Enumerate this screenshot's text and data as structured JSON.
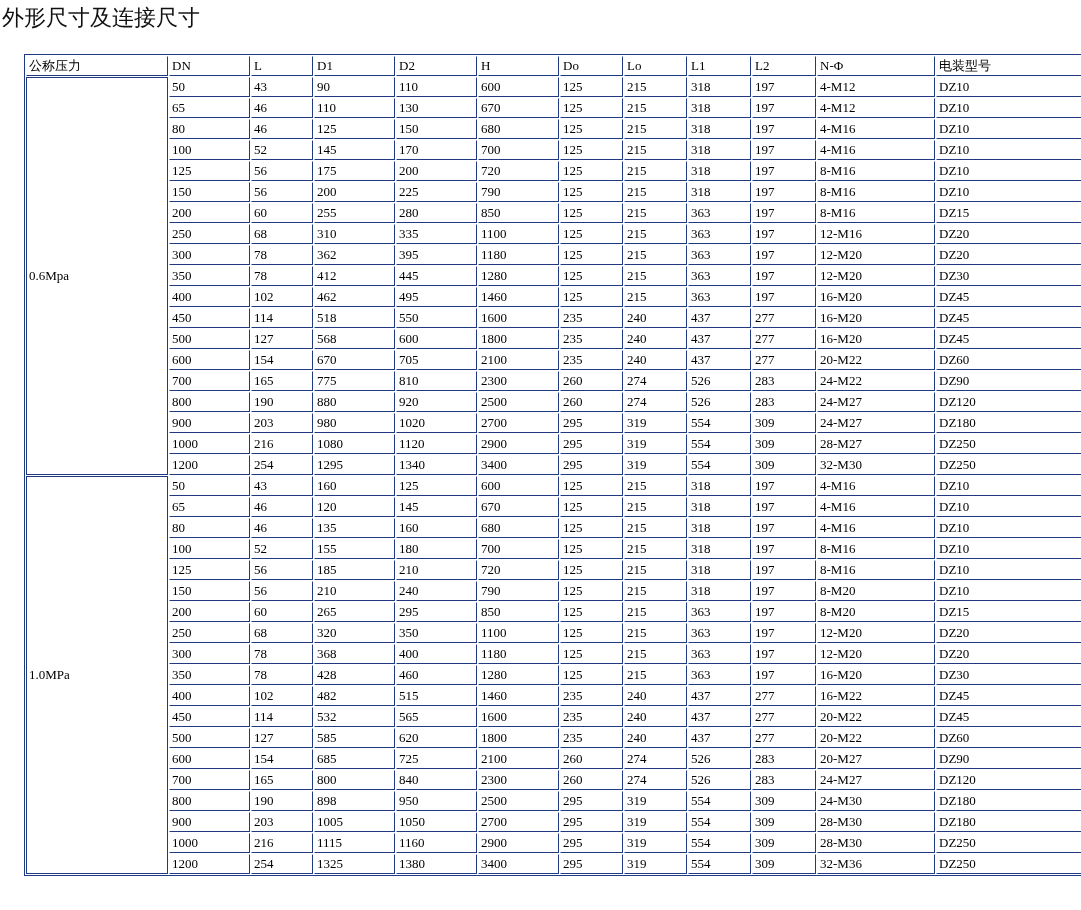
{
  "title": "外形尺寸及连接尺寸",
  "table": {
    "columns": [
      "公称压力",
      "DN",
      "L",
      "D1",
      "D2",
      "H",
      "Do",
      "Lo",
      "L1",
      "L2",
      "N-Φ",
      "电装型号"
    ],
    "groups": [
      {
        "pressure": "0.6Mpa",
        "rows": [
          [
            "50",
            "43",
            "90",
            "110",
            "600",
            "125",
            "215",
            "318",
            "197",
            "4-M12",
            "DZ10"
          ],
          [
            "65",
            "46",
            "110",
            "130",
            "670",
            "125",
            "215",
            "318",
            "197",
            "4-M12",
            "DZ10"
          ],
          [
            "80",
            "46",
            "125",
            "150",
            "680",
            "125",
            "215",
            "318",
            "197",
            "4-M16",
            "DZ10"
          ],
          [
            "100",
            "52",
            "145",
            "170",
            "700",
            "125",
            "215",
            "318",
            "197",
            "4-M16",
            "DZ10"
          ],
          [
            "125",
            "56",
            "175",
            "200",
            "720",
            "125",
            "215",
            "318",
            "197",
            "8-M16",
            "DZ10"
          ],
          [
            "150",
            "56",
            "200",
            "225",
            "790",
            "125",
            "215",
            "318",
            "197",
            "8-M16",
            "DZ10"
          ],
          [
            "200",
            "60",
            "255",
            "280",
            "850",
            "125",
            "215",
            "363",
            "197",
            "8-M16",
            "DZ15"
          ],
          [
            "250",
            "68",
            "310",
            "335",
            "1100",
            "125",
            "215",
            "363",
            "197",
            "12-M16",
            "DZ20"
          ],
          [
            "300",
            "78",
            "362",
            "395",
            "1180",
            "125",
            "215",
            "363",
            "197",
            "12-M20",
            "DZ20"
          ],
          [
            "350",
            "78",
            "412",
            "445",
            "1280",
            "125",
            "215",
            "363",
            "197",
            "12-M20",
            "DZ30"
          ],
          [
            "400",
            "102",
            "462",
            "495",
            "1460",
            "125",
            "215",
            "363",
            "197",
            "16-M20",
            "DZ45"
          ],
          [
            "450",
            "114",
            "518",
            "550",
            "1600",
            "235",
            "240",
            "437",
            "277",
            "16-M20",
            "DZ45"
          ],
          [
            "500",
            "127",
            "568",
            "600",
            "1800",
            "235",
            "240",
            "437",
            "277",
            "16-M20",
            "DZ45"
          ],
          [
            "600",
            "154",
            "670",
            "705",
            "2100",
            "235",
            "240",
            "437",
            "277",
            "20-M22",
            "DZ60"
          ],
          [
            "700",
            "165",
            "775",
            "810",
            "2300",
            "260",
            "274",
            "526",
            "283",
            "24-M22",
            "DZ90"
          ],
          [
            "800",
            "190",
            "880",
            "920",
            "2500",
            "260",
            "274",
            "526",
            "283",
            "24-M27",
            "DZ120"
          ],
          [
            "900",
            "203",
            "980",
            "1020",
            "2700",
            "295",
            "319",
            "554",
            "309",
            "24-M27",
            "DZ180"
          ],
          [
            "1000",
            "216",
            "1080",
            "1120",
            "2900",
            "295",
            "319",
            "554",
            "309",
            "28-M27",
            "DZ250"
          ],
          [
            "1200",
            "254",
            "1295",
            "1340",
            "3400",
            "295",
            "319",
            "554",
            "309",
            "32-M30",
            "DZ250"
          ]
        ]
      },
      {
        "pressure": "1.0MPa",
        "rows": [
          [
            "50",
            "43",
            "160",
            "125",
            "600",
            "125",
            "215",
            "318",
            "197",
            "4-M16",
            "DZ10"
          ],
          [
            "65",
            "46",
            "120",
            "145",
            "670",
            "125",
            "215",
            "318",
            "197",
            "4-M16",
            "DZ10"
          ],
          [
            "80",
            "46",
            "135",
            "160",
            "680",
            "125",
            "215",
            "318",
            "197",
            "4-M16",
            "DZ10"
          ],
          [
            "100",
            "52",
            "155",
            "180",
            "700",
            "125",
            "215",
            "318",
            "197",
            "8-M16",
            "DZ10"
          ],
          [
            "125",
            "56",
            "185",
            "210",
            "720",
            "125",
            "215",
            "318",
            "197",
            "8-M16",
            "DZ10"
          ],
          [
            "150",
            "56",
            "210",
            "240",
            "790",
            "125",
            "215",
            "318",
            "197",
            "8-M20",
            "DZ10"
          ],
          [
            "200",
            "60",
            "265",
            "295",
            "850",
            "125",
            "215",
            "363",
            "197",
            "8-M20",
            "DZ15"
          ],
          [
            "250",
            "68",
            "320",
            "350",
            "1100",
            "125",
            "215",
            "363",
            "197",
            "12-M20",
            "DZ20"
          ],
          [
            "300",
            "78",
            "368",
            "400",
            "1180",
            "125",
            "215",
            "363",
            "197",
            "12-M20",
            "DZ20"
          ],
          [
            "350",
            "78",
            "428",
            "460",
            "1280",
            "125",
            "215",
            "363",
            "197",
            "16-M20",
            "DZ30"
          ],
          [
            "400",
            "102",
            "482",
            "515",
            "1460",
            "235",
            "240",
            "437",
            "277",
            "16-M22",
            "DZ45"
          ],
          [
            "450",
            "114",
            "532",
            "565",
            "1600",
            "235",
            "240",
            "437",
            "277",
            "20-M22",
            "DZ45"
          ],
          [
            "500",
            "127",
            "585",
            "620",
            "1800",
            "235",
            "240",
            "437",
            "277",
            "20-M22",
            "DZ60"
          ],
          [
            "600",
            "154",
            "685",
            "725",
            "2100",
            "260",
            "274",
            "526",
            "283",
            "20-M27",
            "DZ90"
          ],
          [
            "700",
            "165",
            "800",
            "840",
            "2300",
            "260",
            "274",
            "526",
            "283",
            "24-M27",
            "DZ120"
          ],
          [
            "800",
            "190",
            "898",
            "950",
            "2500",
            "295",
            "319",
            "554",
            "309",
            "24-M30",
            "DZ180"
          ],
          [
            "900",
            "203",
            "1005",
            "1050",
            "2700",
            "295",
            "319",
            "554",
            "309",
            "28-M30",
            "DZ180"
          ],
          [
            "1000",
            "216",
            "1115",
            "1160",
            "2900",
            "295",
            "319",
            "554",
            "309",
            "28-M30",
            "DZ250"
          ],
          [
            "1200",
            "254",
            "1325",
            "1380",
            "3400",
            "295",
            "319",
            "554",
            "309",
            "32-M36",
            "DZ250"
          ]
        ]
      }
    ]
  }
}
